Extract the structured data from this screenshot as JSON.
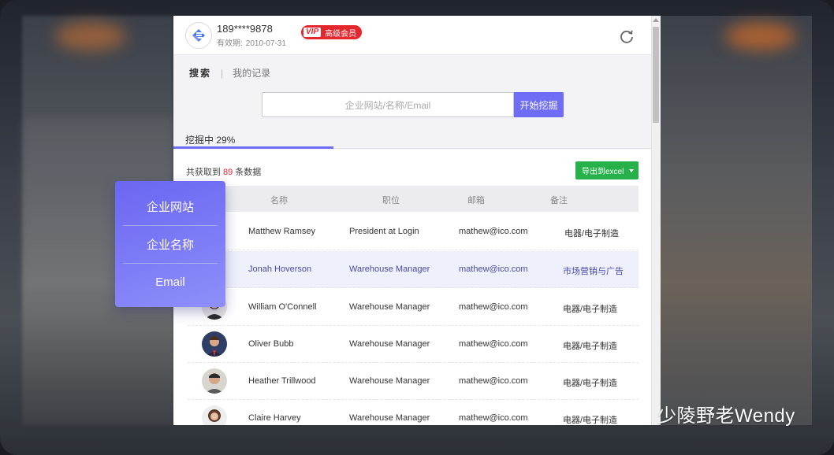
{
  "header": {
    "phone": "189****9878",
    "validity_label": "有效期:",
    "validity_date": "2010-07-31",
    "vip_tag": "VIP",
    "vip_label": "高级会员"
  },
  "nav": {
    "search_tab": "搜索",
    "records_tab": "我的记录"
  },
  "search": {
    "placeholder": "企业网站/名称/Email",
    "button": "开始挖掘"
  },
  "progress_tab": {
    "label": "挖掘中 29%",
    "percent": 29
  },
  "results": {
    "prefix": "共获取到",
    "count": "89",
    "suffix": "条数据",
    "export_label": "导出到excel"
  },
  "table": {
    "headers": [
      "名称",
      "职位",
      "邮箱",
      "备注"
    ],
    "rows": [
      {
        "name": "Matthew Ramsey",
        "position": "President at Login",
        "email": "mathew@ico.com",
        "note": "电器/电子制造"
      },
      {
        "name": "Jonah Hoverson",
        "position": "Warehouse Manager",
        "email": "mathew@ico.com",
        "note": "市场营销与广告"
      },
      {
        "name": "William O'Connell",
        "position": "Warehouse Manager",
        "email": "mathew@ico.com",
        "note": "电器/电子制造"
      },
      {
        "name": "Oliver Bubb",
        "position": "Warehouse Manager",
        "email": "mathew@ico.com",
        "note": "电器/电子制造"
      },
      {
        "name": "Heather Trillwood",
        "position": "Warehouse Manager",
        "email": "mathew@ico.com",
        "note": "电器/电子制造"
      },
      {
        "name": "Claire Harvey",
        "position": "Warehouse Manager",
        "email": "mathew@ico.com",
        "note": "电器/电子制造"
      }
    ]
  },
  "dropdown": {
    "items": [
      "企业网站",
      "企业名称",
      "Email"
    ]
  },
  "watermark": {
    "text": "少陵野老Wendy"
  },
  "colors": {
    "accent": "#6f6cf5",
    "vip_red": "#e4262d",
    "export_green": "#27b14a"
  }
}
